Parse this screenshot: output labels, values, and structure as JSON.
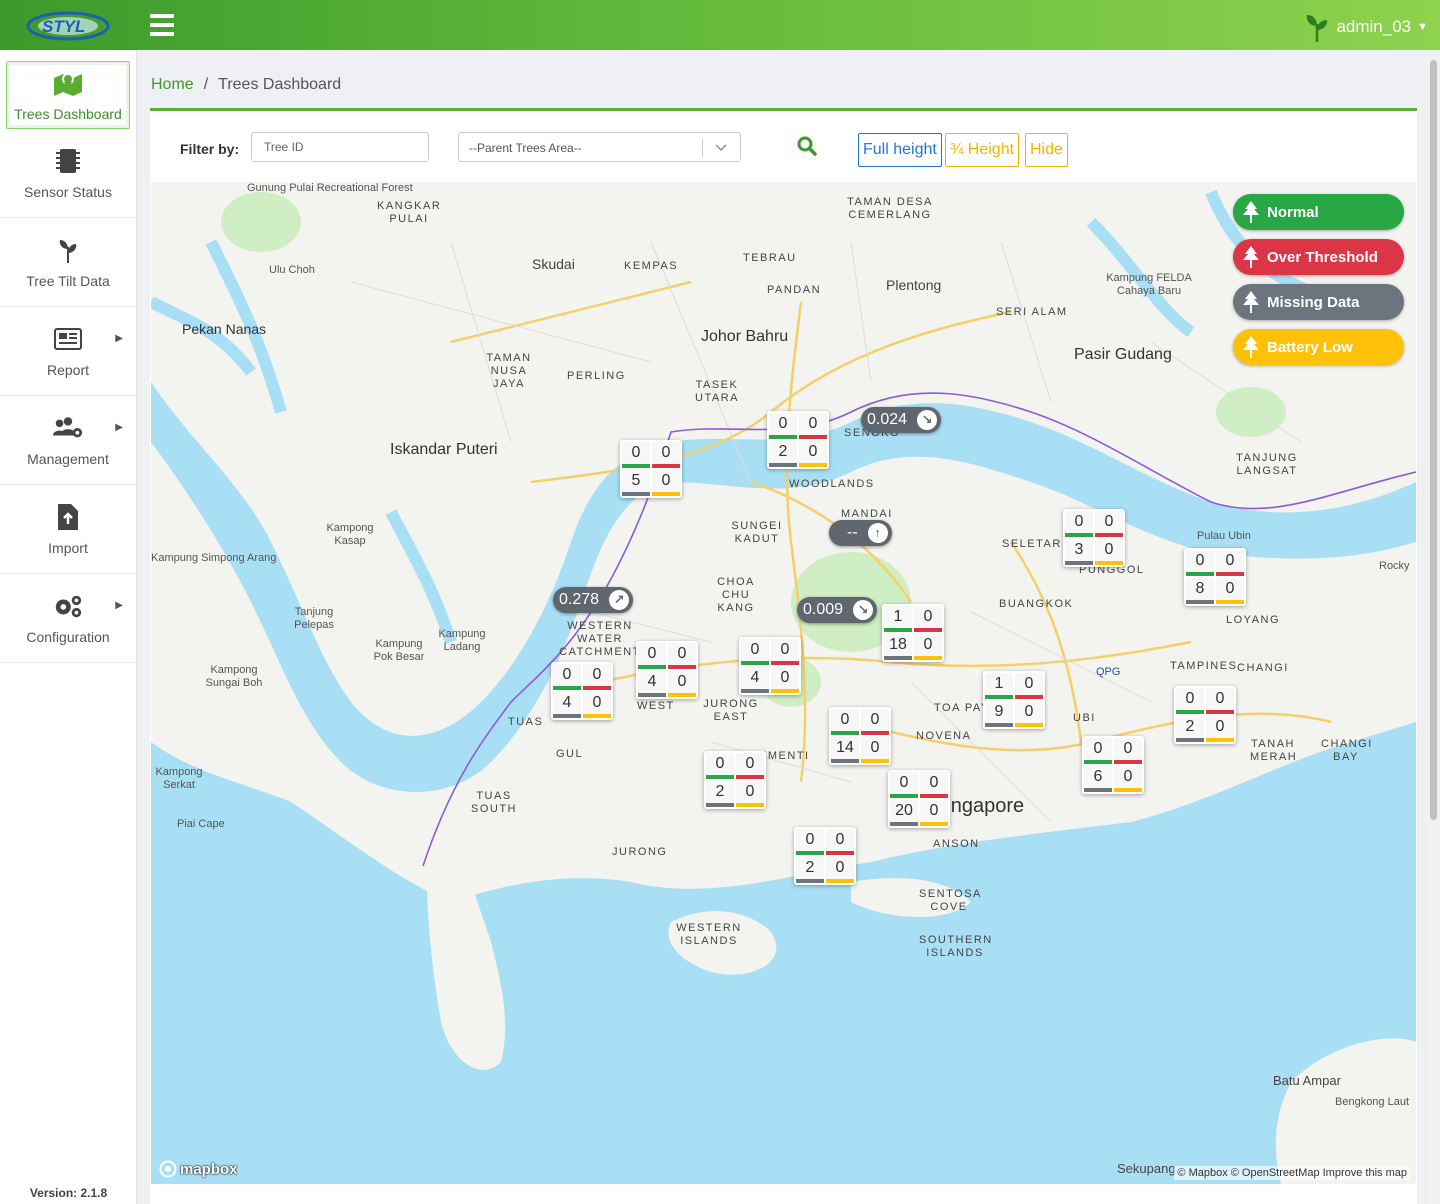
{
  "header": {
    "logo_text": "STYL",
    "username": "admin_03"
  },
  "sidebar": {
    "items": [
      {
        "label": "Trees Dashboard",
        "icon": "map-marker-icon"
      },
      {
        "label": "Sensor Status",
        "icon": "chip-icon"
      },
      {
        "label": "Tree Tilt Data",
        "icon": "sprout-icon"
      },
      {
        "label": "Report",
        "icon": "newspaper-icon"
      },
      {
        "label": "Management",
        "icon": "users-gear-icon"
      },
      {
        "label": "Import",
        "icon": "file-import-icon"
      },
      {
        "label": "Configuration",
        "icon": "gears-icon"
      }
    ],
    "version": "Version: 2.1.8"
  },
  "breadcrumb": {
    "home": "Home",
    "separator": "/",
    "current": "Trees Dashboard"
  },
  "filter": {
    "label": "Filter by:",
    "tree_id_placeholder": "Tree ID",
    "area_placeholder": "--Parent Trees Area--",
    "buttons": {
      "full": "Full height",
      "three_quarter": "¾ Height",
      "hide": "Hide"
    }
  },
  "legend": {
    "normal": "Normal",
    "over": "Over Threshold",
    "missing": "Missing Data",
    "battery": "Battery Low"
  },
  "colors": {
    "normal": "#28a745",
    "over": "#dc3545",
    "missing": "#6c757d",
    "battery": "#ffc107",
    "brand": "#5aac33"
  },
  "map": {
    "attribution": "© Mapbox © OpenStreetMap Improve this map",
    "mapbox_logo": "mapbox",
    "places": [
      "Skudai",
      "KEMPAS",
      "TEBRAU",
      "PANDAN",
      "Plentong",
      "TAMAN DESA CEMERLANG",
      "Johor Bahru",
      "Pasir Gudang",
      "SERI ALAM",
      "Kampung FELDA Cahaya Baru",
      "Pekan Nanas",
      "KANGKAR PULAI",
      "Ulu Choh",
      "TAMAN NUSA JAYA",
      "PERLING",
      "TASEK UTARA",
      "Iskandar Puteri",
      "SENOKO",
      "WOODLANDS",
      "MANDAI",
      "SUNGEI KADUT",
      "SELETAR",
      "PUNGGOL",
      "CHOA CHU KANG",
      "BUANGKOK",
      "Pulau Ubin",
      "TANJUNG LANGSAT",
      "Rocky",
      "LOYANG",
      "WESTERN WATER CATCHMENT",
      "JURONG EAST",
      "WEST",
      "TOA PAYOH",
      "TAMPINES",
      "CHANGI",
      "QPG",
      "UBI",
      "NOVENA",
      "TANAH MERAH",
      "CHANGI BAY",
      "TUAS",
      "GUL",
      "TUAS SOUTH",
      "CLEMENTI",
      "Singapore",
      "ANSON",
      "JURONG",
      "SENTOSA COVE",
      "WESTERN ISLANDS",
      "SOUTHERN ISLANDS",
      "Batu Ampar",
      "Bengkong Laut",
      "Sekupang",
      "Piai Cape",
      "Kampong Serkat",
      "Kampong Sungai Boh",
      "Kampung Pok Besar",
      "Kampung Ladang",
      "Tanjung Pelepas",
      "Kampung Simpong Arang",
      "Kampong Kasap",
      "Gunung Pulai Recreational Forest"
    ],
    "clusters": [
      {
        "normal": 0,
        "over": 0,
        "missing": 5,
        "battery": 0
      },
      {
        "normal": 0,
        "over": 0,
        "missing": 2,
        "battery": 0
      },
      {
        "normal": 0,
        "over": 0,
        "missing": 3,
        "battery": 0
      },
      {
        "normal": 0,
        "over": 0,
        "missing": 8,
        "battery": 0
      },
      {
        "normal": 1,
        "over": 0,
        "missing": 18,
        "battery": 0
      },
      {
        "normal": 0,
        "over": 0,
        "missing": 4,
        "battery": 0
      },
      {
        "normal": 0,
        "over": 0,
        "missing": 4,
        "battery": 0
      },
      {
        "normal": 0,
        "over": 0,
        "missing": 4,
        "battery": 0
      },
      {
        "normal": 1,
        "over": 0,
        "missing": 9,
        "battery": 0
      },
      {
        "normal": 0,
        "over": 0,
        "missing": 2,
        "battery": 0
      },
      {
        "normal": 0,
        "over": 0,
        "missing": 14,
        "battery": 0
      },
      {
        "normal": 0,
        "over": 0,
        "missing": 6,
        "battery": 0
      },
      {
        "normal": 0,
        "over": 0,
        "missing": 2,
        "battery": 0
      },
      {
        "normal": 0,
        "over": 0,
        "missing": 20,
        "battery": 0
      },
      {
        "normal": 0,
        "over": 0,
        "missing": 2,
        "battery": 0
      }
    ],
    "pills": [
      {
        "value": "0.024",
        "dir": "↘"
      },
      {
        "value": "--",
        "dir": "↑"
      },
      {
        "value": "0.278",
        "dir": "↗"
      },
      {
        "value": "0.009",
        "dir": "↘"
      }
    ]
  }
}
